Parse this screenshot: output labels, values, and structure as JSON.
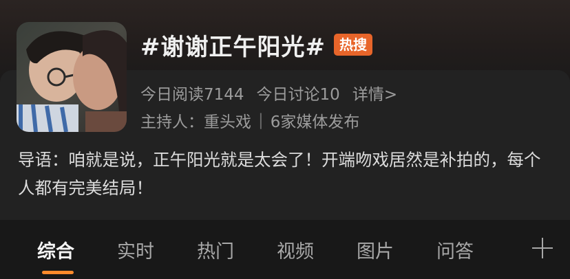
{
  "topic": {
    "title": "#谢谢正午阳光#",
    "badge": "热搜",
    "reads": "今日阅读7144",
    "discussions": "今日讨论10",
    "details_link": "详情>",
    "host_label": "主持人：",
    "host_name": "重头戏",
    "host_separator": "|",
    "publishers": "6家媒体发布",
    "intro": "导语：咱就是说，正午阳光就是太会了！开端吻戏居然是补拍的，每个人都有完美结局！"
  },
  "tabs": [
    {
      "label": "综合",
      "active": true
    },
    {
      "label": "实时",
      "active": false
    },
    {
      "label": "热门",
      "active": false
    },
    {
      "label": "视频",
      "active": false
    },
    {
      "label": "图片",
      "active": false
    },
    {
      "label": "问答",
      "active": false
    }
  ],
  "colors": {
    "badge": "#e8652a",
    "tab_indicator": "#ff8a2b",
    "background": "#181818",
    "card": "#222222"
  },
  "icons": {
    "add_tab": "plus-icon"
  }
}
